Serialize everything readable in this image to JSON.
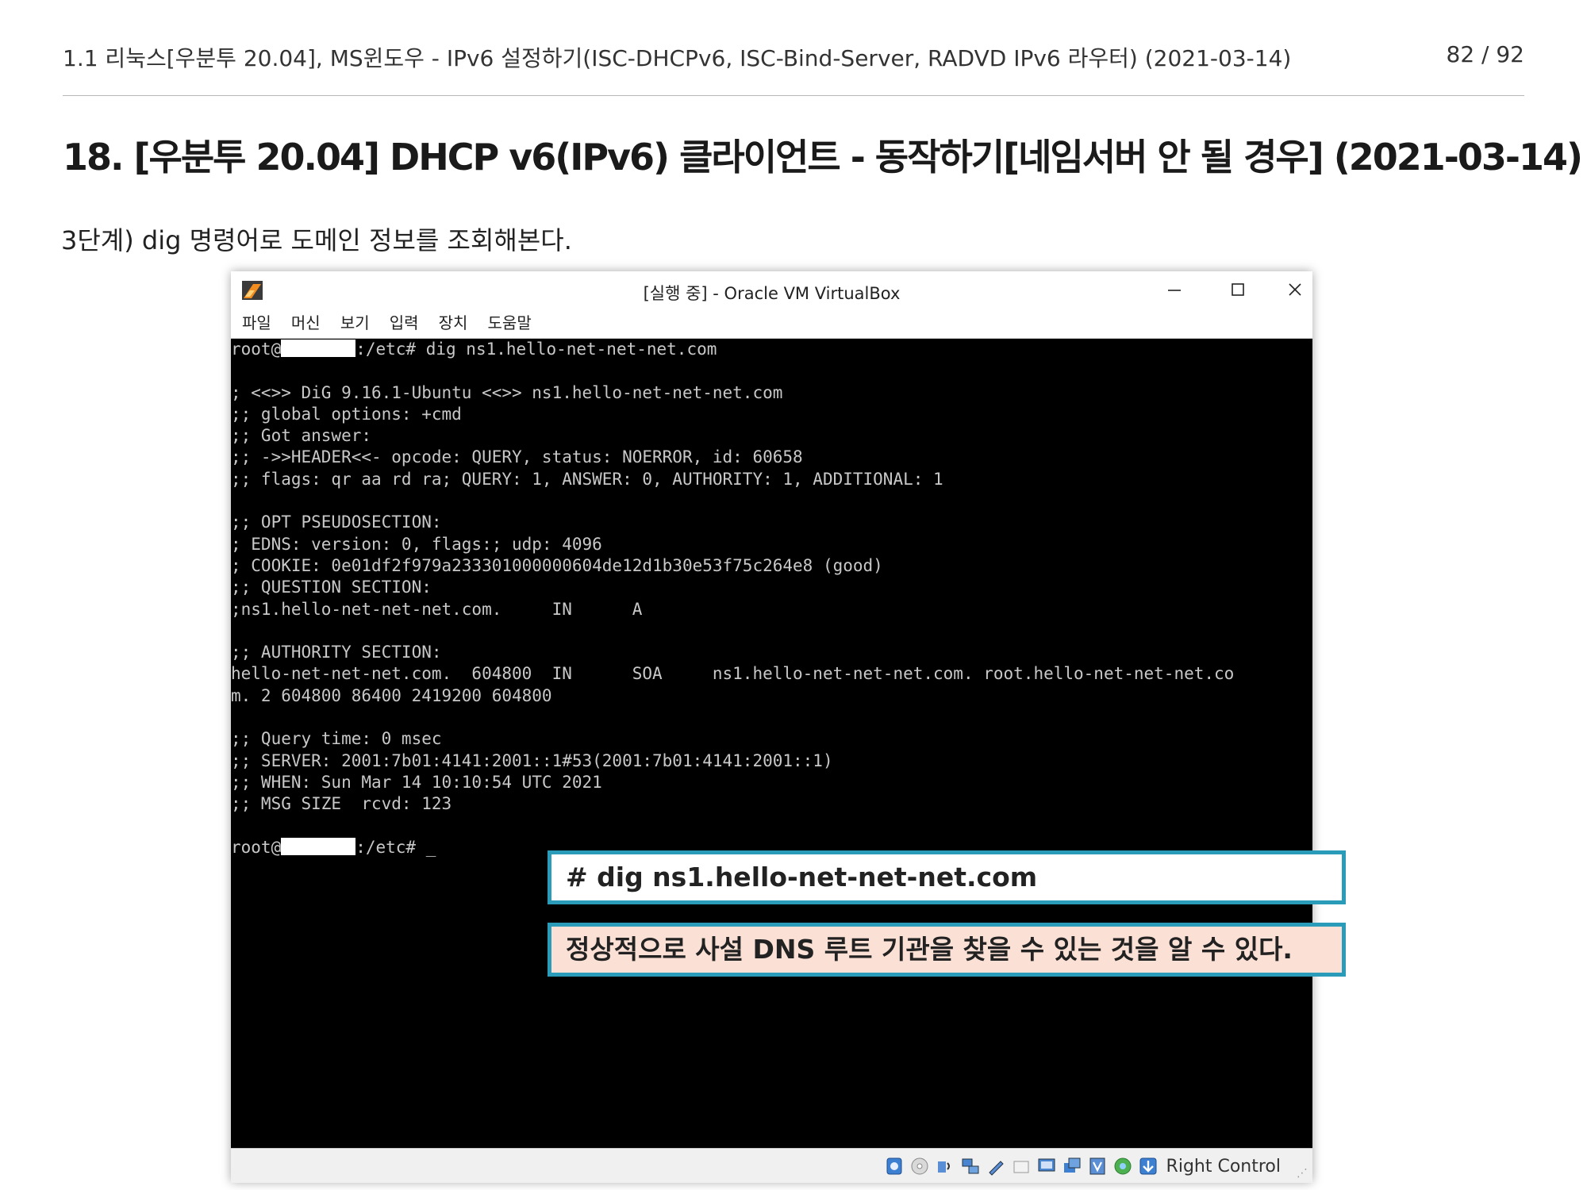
{
  "header": {
    "title": "1.1 리눅스[우분투 20.04], MS윈도우 - IPv6 설정하기(ISC-DHCPv6, ISC-Bind-Server, RADVD IPv6 라우터) (2021-03-14)",
    "page": "82 / 92"
  },
  "section_title": "18. [우분투 20.04] DHCP v6(IPv6) 클라이언트 - 동작하기[네임서버 안 될 경우] (2021-03-14)",
  "step_text": "3단계) dig 명령어로 도메인 정보를 조회해본다.",
  "window": {
    "title": "[실행 중] - Oracle VM VirtualBox",
    "menu": [
      "파일",
      "머신",
      "보기",
      "입력",
      "장치",
      "도움말"
    ],
    "host_key": "Right Control"
  },
  "console": {
    "prompt_user": "root@",
    "prompt_path": ":/etc# ",
    "command": "dig ns1.hello-net-net-net.com",
    "output": [
      "",
      "; <<>> DiG 9.16.1-Ubuntu <<>> ns1.hello-net-net-net.com",
      ";; global options: +cmd",
      ";; Got answer:",
      ";; ->>HEADER<<- opcode: QUERY, status: NOERROR, id: 60658",
      ";; flags: qr aa rd ra; QUERY: 1, ANSWER: 0, AUTHORITY: 1, ADDITIONAL: 1",
      "",
      ";; OPT PSEUDOSECTION:",
      "; EDNS: version: 0, flags:; udp: 4096",
      "; COOKIE: 0e01df2f979a233301000000604de12d1b30e53f75c264e8 (good)",
      ";; QUESTION SECTION:",
      ";ns1.hello-net-net-net.com.     IN      A",
      "",
      ";; AUTHORITY SECTION:",
      "hello-net-net-net.com.  604800  IN      SOA     ns1.hello-net-net-net.com. root.hello-net-net-net.co",
      "m. 2 604800 86400 2419200 604800",
      "",
      ";; Query time: 0 msec",
      ";; SERVER: 2001:7b01:4141:2001::1#53(2001:7b01:4141:2001::1)",
      ";; WHEN: Sun Mar 14 10:10:54 UTC 2021",
      ";; MSG SIZE  rcvd: 123",
      ""
    ],
    "cursor": "_"
  },
  "callouts": {
    "command": "# dig ns1.hello-net-net-net.com",
    "note": "정상적으로 사설 DNS 루트 기관을 찾을 수 있는 것을 알 수 있다."
  },
  "colors": {
    "callout_border": "#2a9bb8",
    "callout_note_bg": "#fbe0d5",
    "console_bg": "#000000",
    "console_text": "#c8c8c8"
  }
}
